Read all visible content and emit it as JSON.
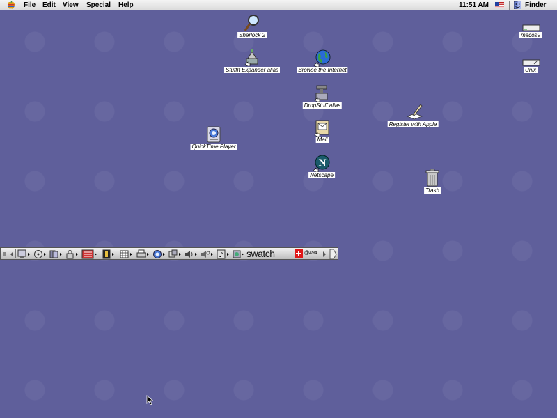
{
  "menubar": {
    "menus": [
      "File",
      "Edit",
      "View",
      "Special",
      "Help"
    ],
    "time": "11:51 AM",
    "app_name": "Finder"
  },
  "desktop": {
    "icons": [
      {
        "id": "sherlock",
        "label": "Sherlock 2",
        "icon": "magnifier-icon"
      },
      {
        "id": "stuffit",
        "label": "StuffIt Expander alias",
        "icon": "stuffit-icon"
      },
      {
        "id": "browse",
        "label": "Browse the Internet",
        "icon": "globe-icon"
      },
      {
        "id": "dropstuff",
        "label": "DropStuff alias",
        "icon": "dropstuff-icon"
      },
      {
        "id": "quicktime",
        "label": "QuickTime Player",
        "icon": "quicktime-icon"
      },
      {
        "id": "mail",
        "label": "Mail",
        "icon": "mail-icon"
      },
      {
        "id": "netscape",
        "label": "Netscape",
        "icon": "netscape-icon"
      },
      {
        "id": "register",
        "label": "Register with Apple",
        "icon": "pen-icon"
      },
      {
        "id": "trash",
        "label": "Trash",
        "icon": "trash-icon"
      },
      {
        "id": "macos9",
        "label": "macos9",
        "icon": "hard-disk-icon"
      },
      {
        "id": "unix",
        "label": "Unix",
        "icon": "hard-disk-icon"
      }
    ]
  },
  "control_strip": {
    "brand": "swatch",
    "beat_time": "@494"
  },
  "colors": {
    "desktop": "#5f5f9b",
    "menubar": "#e6e6e6"
  }
}
